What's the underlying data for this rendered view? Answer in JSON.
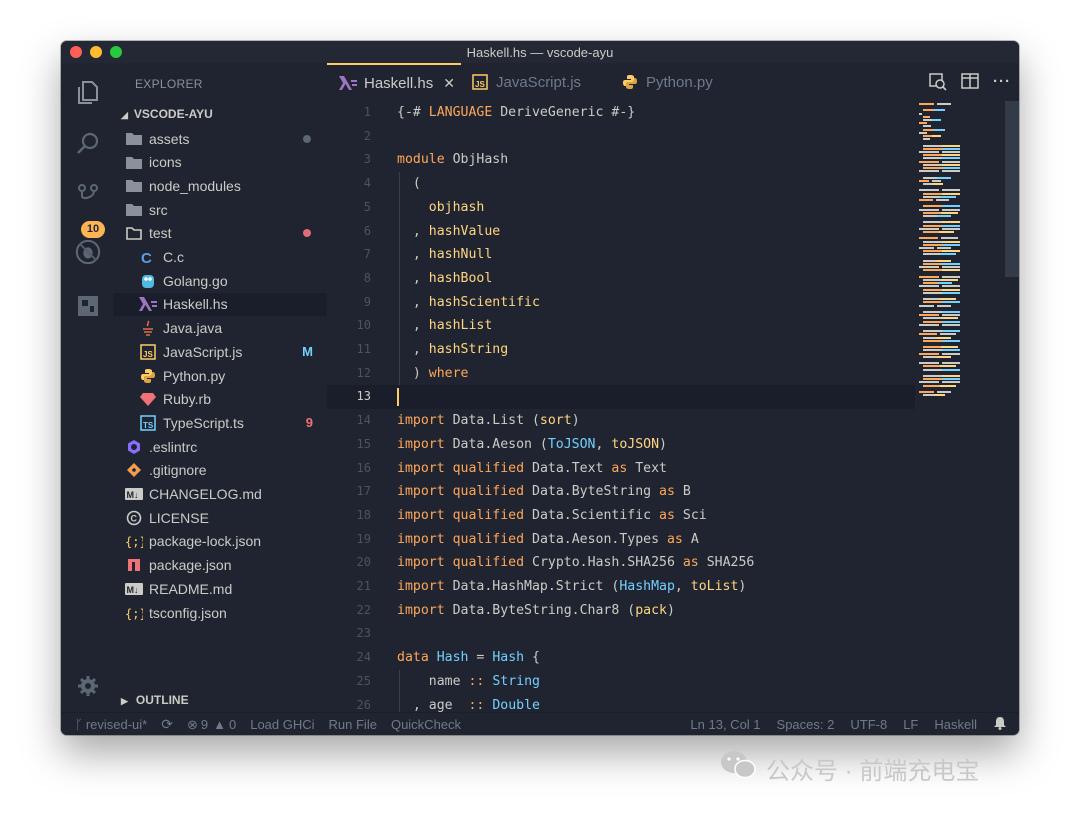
{
  "window": {
    "title": "Haskell.hs — vscode-ayu"
  },
  "activity": {
    "scm_badge": "10"
  },
  "sidebar": {
    "title": "EXPLORER",
    "project": "VSCODE-AYU",
    "items": [
      {
        "label": "assets",
        "kind": "folder",
        "depth": 0
      },
      {
        "label": "icons",
        "kind": "folder",
        "depth": 0
      },
      {
        "label": "node_modules",
        "kind": "folder",
        "depth": 0
      },
      {
        "label": "src",
        "kind": "folder",
        "depth": 0
      },
      {
        "label": "test",
        "kind": "folder-open",
        "depth": 0
      },
      {
        "label": "C.c",
        "kind": "c",
        "depth": 1
      },
      {
        "label": "Golang.go",
        "kind": "go",
        "depth": 1
      },
      {
        "label": "Haskell.hs",
        "kind": "haskell",
        "depth": 1
      },
      {
        "label": "Java.java",
        "kind": "java",
        "depth": 1
      },
      {
        "label": "JavaScript.js",
        "kind": "js",
        "depth": 1,
        "decoration": "M"
      },
      {
        "label": "Python.py",
        "kind": "python",
        "depth": 1
      },
      {
        "label": "Ruby.rb",
        "kind": "ruby",
        "depth": 1
      },
      {
        "label": "TypeScript.ts",
        "kind": "ts",
        "depth": 1,
        "decoration": "9"
      },
      {
        "label": ".eslintrc",
        "kind": "eslint",
        "depth": 0
      },
      {
        "label": ".gitignore",
        "kind": "git",
        "depth": 0
      },
      {
        "label": "CHANGELOG.md",
        "kind": "md",
        "depth": 0
      },
      {
        "label": "LICENSE",
        "kind": "license",
        "depth": 0
      },
      {
        "label": "package-lock.json",
        "kind": "json",
        "depth": 0
      },
      {
        "label": "package.json",
        "kind": "npm",
        "depth": 0
      },
      {
        "label": "README.md",
        "kind": "md",
        "depth": 0
      },
      {
        "label": "tsconfig.json",
        "kind": "json",
        "depth": 0
      }
    ],
    "outline": "OUTLINE"
  },
  "tabs": [
    {
      "label": "Haskell.hs",
      "active": true
    },
    {
      "label": "JavaScript.js",
      "active": false
    },
    {
      "label": "Python.py",
      "active": false
    }
  ],
  "editor": {
    "current_line": 13,
    "lines": [
      {
        "n": "1",
        "code": [
          [
            "{-# ",
            "cm"
          ],
          [
            "LANGUAGE",
            "kw"
          ],
          [
            " DeriveGeneric #-}",
            "cm"
          ]
        ]
      },
      {
        "n": "2",
        "code": []
      },
      {
        "n": "3",
        "code": [
          [
            "module",
            "kw"
          ],
          [
            " ObjHash",
            "cm"
          ]
        ]
      },
      {
        "n": "4",
        "code": [
          [
            "  (",
            "cm"
          ]
        ]
      },
      {
        "n": "5",
        "code": [
          [
            "    ",
            "cm"
          ],
          [
            "objhash",
            "fn"
          ]
        ]
      },
      {
        "n": "6",
        "code": [
          [
            "  , ",
            "cm"
          ],
          [
            "hashValue",
            "fn"
          ]
        ]
      },
      {
        "n": "7",
        "code": [
          [
            "  , ",
            "cm"
          ],
          [
            "hashNull",
            "fn"
          ]
        ]
      },
      {
        "n": "8",
        "code": [
          [
            "  , ",
            "cm"
          ],
          [
            "hashBool",
            "fn"
          ]
        ]
      },
      {
        "n": "9",
        "code": [
          [
            "  , ",
            "cm"
          ],
          [
            "hashScientific",
            "fn"
          ]
        ]
      },
      {
        "n": "10",
        "code": [
          [
            "  , ",
            "cm"
          ],
          [
            "hashList",
            "fn"
          ]
        ]
      },
      {
        "n": "11",
        "code": [
          [
            "  , ",
            "cm"
          ],
          [
            "hashString",
            "fn"
          ]
        ]
      },
      {
        "n": "12",
        "code": [
          [
            "  ) ",
            "cm"
          ],
          [
            "where",
            "kw"
          ]
        ]
      },
      {
        "n": "13",
        "code": []
      },
      {
        "n": "14",
        "code": [
          [
            "import",
            "kw"
          ],
          [
            " Data.List (",
            "cm"
          ],
          [
            "sort",
            "fn"
          ],
          [
            ")",
            "cm"
          ]
        ]
      },
      {
        "n": "15",
        "code": [
          [
            "import",
            "kw"
          ],
          [
            " Data.Aeson (",
            "cm"
          ],
          [
            "ToJSON",
            "ty"
          ],
          [
            ", ",
            "cm"
          ],
          [
            "toJSON",
            "fn"
          ],
          [
            ")",
            "cm"
          ]
        ]
      },
      {
        "n": "16",
        "code": [
          [
            "import",
            "kw"
          ],
          [
            " ",
            "cm"
          ],
          [
            "qualified",
            "kw"
          ],
          [
            " Data.Text ",
            "cm"
          ],
          [
            "as",
            "kw"
          ],
          [
            " Text",
            "cm"
          ]
        ]
      },
      {
        "n": "17",
        "code": [
          [
            "import",
            "kw"
          ],
          [
            " ",
            "cm"
          ],
          [
            "qualified",
            "kw"
          ],
          [
            " Data.ByteString ",
            "cm"
          ],
          [
            "as",
            "kw"
          ],
          [
            " B",
            "cm"
          ]
        ]
      },
      {
        "n": "18",
        "code": [
          [
            "import",
            "kw"
          ],
          [
            " ",
            "cm"
          ],
          [
            "qualified",
            "kw"
          ],
          [
            " Data.Scientific ",
            "cm"
          ],
          [
            "as",
            "kw"
          ],
          [
            " Sci",
            "cm"
          ]
        ]
      },
      {
        "n": "19",
        "code": [
          [
            "import",
            "kw"
          ],
          [
            " ",
            "cm"
          ],
          [
            "qualified",
            "kw"
          ],
          [
            " Data.Aeson.Types ",
            "cm"
          ],
          [
            "as",
            "kw"
          ],
          [
            " A",
            "cm"
          ]
        ]
      },
      {
        "n": "20",
        "code": [
          [
            "import",
            "kw"
          ],
          [
            " ",
            "cm"
          ],
          [
            "qualified",
            "kw"
          ],
          [
            " Crypto.Hash.SHA256 ",
            "cm"
          ],
          [
            "as",
            "kw"
          ],
          [
            " SHA256",
            "cm"
          ]
        ]
      },
      {
        "n": "21",
        "code": [
          [
            "import",
            "kw"
          ],
          [
            " Data.HashMap.Strict (",
            "cm"
          ],
          [
            "HashMap",
            "ty"
          ],
          [
            ", ",
            "cm"
          ],
          [
            "toList",
            "fn"
          ],
          [
            ")",
            "cm"
          ]
        ]
      },
      {
        "n": "22",
        "code": [
          [
            "import",
            "kw"
          ],
          [
            " Data.ByteString.Char8 (",
            "cm"
          ],
          [
            "pack",
            "fn"
          ],
          [
            ")",
            "cm"
          ]
        ]
      },
      {
        "n": "23",
        "code": []
      },
      {
        "n": "24",
        "code": [
          [
            "data",
            "kw"
          ],
          [
            " ",
            "cm"
          ],
          [
            "Hash",
            "ty"
          ],
          [
            " = ",
            "cm"
          ],
          [
            "Hash",
            "ty"
          ],
          [
            " {",
            "cm"
          ]
        ]
      },
      {
        "n": "25",
        "code": [
          [
            "    name ",
            "cm"
          ],
          [
            "::",
            "kw"
          ],
          [
            " ",
            "cm"
          ],
          [
            "String",
            "ty"
          ]
        ]
      },
      {
        "n": "26",
        "code": [
          [
            "  , age  ",
            "cm"
          ],
          [
            "::",
            "kw"
          ],
          [
            " ",
            "cm"
          ],
          [
            "Double",
            "ty"
          ]
        ]
      }
    ]
  },
  "statusbar": {
    "branch": "revised-ui*",
    "errors": "9",
    "warnings": "0",
    "load_ghci": "Load GHCi",
    "run_file": "Run File",
    "quickcheck": "QuickCheck",
    "position": "Ln 13, Col 1",
    "spaces": "Spaces: 2",
    "encoding": "UTF-8",
    "eol": "LF",
    "language": "Haskell"
  },
  "watermark": {
    "text": "公众号 · 前端充电宝"
  },
  "colors": {
    "background": "#1f2430",
    "foreground": "#cbccc6",
    "keyword": "#ffa759",
    "type": "#73d0ff",
    "function": "#ffd580",
    "accent": "#ffcc66",
    "modified_dot": "#e06c75",
    "untracked_dot": "#5c6773"
  }
}
